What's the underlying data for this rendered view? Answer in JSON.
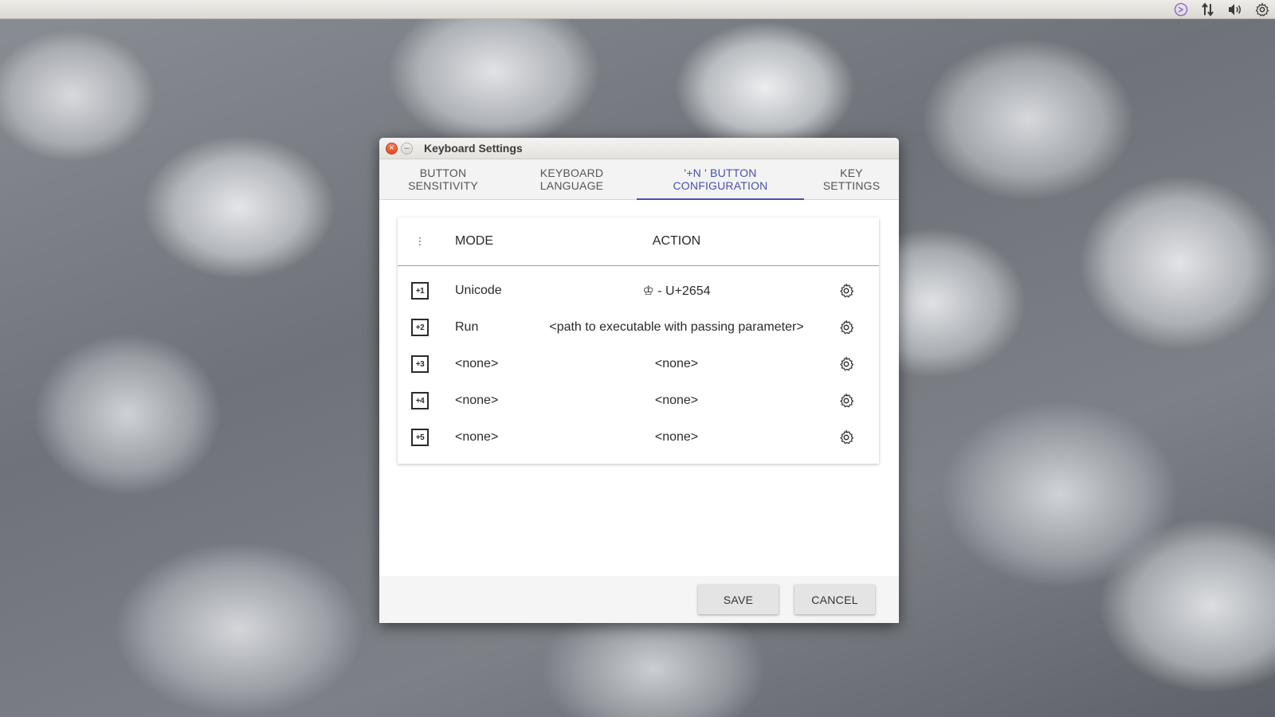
{
  "system_tray": {
    "icons": [
      "input-method-icon",
      "network-arrows-icon",
      "volume-icon",
      "settings-gear-icon"
    ]
  },
  "window": {
    "title": "Keyboard Settings",
    "close_glyph": "×",
    "minimize_glyph": "–"
  },
  "tabs": [
    {
      "label": "BUTTON\nSENSITIVITY",
      "active": false
    },
    {
      "label": "KEYBOARD\nLANGUAGE",
      "active": false
    },
    {
      "label": "'+N ' BUTTON\nCONFIGURATION",
      "active": true
    },
    {
      "label": "KEY\nSETTINGS",
      "active": false
    }
  ],
  "table": {
    "menu_glyph": "⋮",
    "headers": {
      "mode": "MODE",
      "action": "ACTION"
    },
    "rows": [
      {
        "badge": "+1",
        "mode": "Unicode",
        "action": "♔ - U+2654"
      },
      {
        "badge": "+2",
        "mode": "Run",
        "action": "<path to executable with passing parameter>"
      },
      {
        "badge": "+3",
        "mode": "<none>",
        "action": "<none>"
      },
      {
        "badge": "+4",
        "mode": "<none>",
        "action": "<none>"
      },
      {
        "badge": "+5",
        "mode": "<none>",
        "action": "<none>"
      }
    ]
  },
  "footer": {
    "save_label": "SAVE",
    "cancel_label": "CANCEL"
  },
  "colors": {
    "accent": "#4a4fa8",
    "close_button": "#df4a23"
  }
}
